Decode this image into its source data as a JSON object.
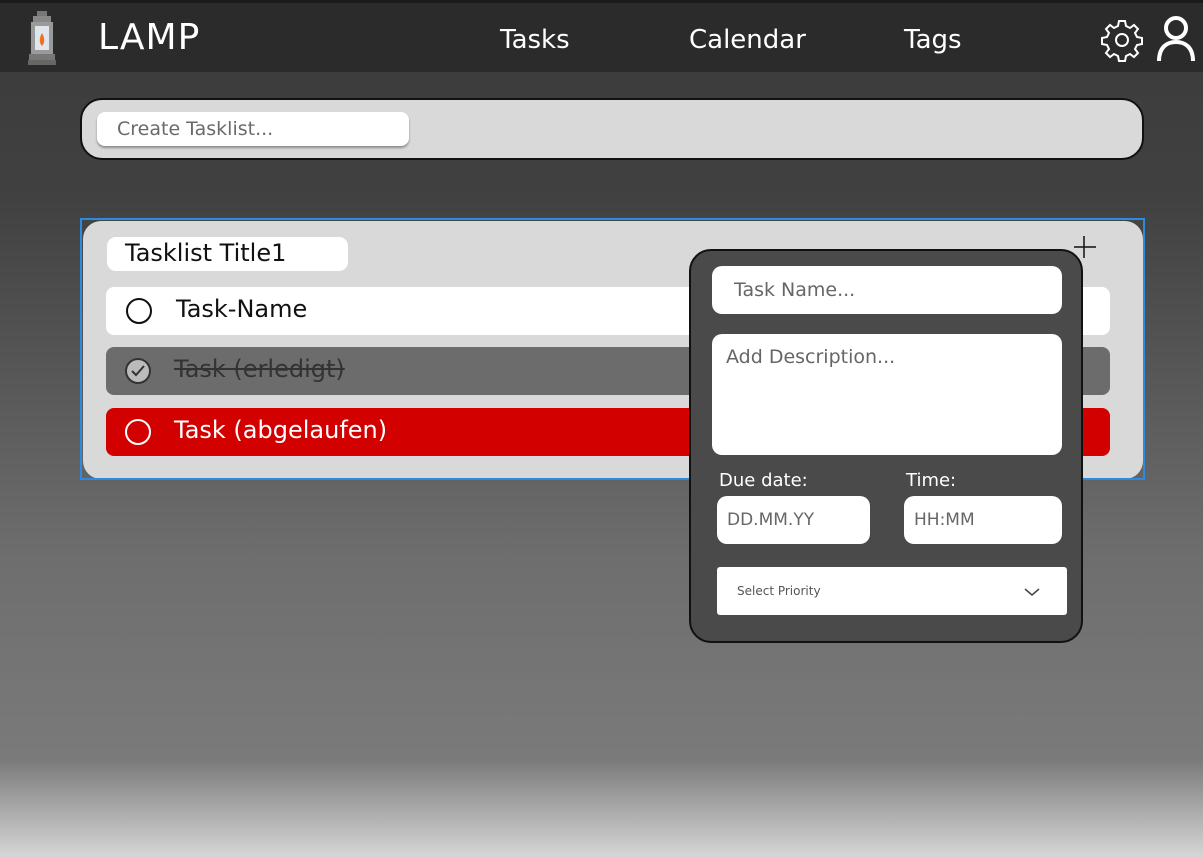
{
  "app": {
    "title": "LAMP"
  },
  "nav": {
    "tasks": "Tasks",
    "calendar": "Calendar",
    "tags": "Tags"
  },
  "create": {
    "placeholder": "Create Tasklist..."
  },
  "tasklist": {
    "title": "Tasklist Title1",
    "tasks": [
      {
        "label": "Task-Name",
        "state": "open"
      },
      {
        "label": "Task (erledigt)",
        "state": "done"
      },
      {
        "label": "Task (abgelaufen)",
        "state": "overdue"
      }
    ]
  },
  "popup": {
    "task_name_placeholder": "Task Name...",
    "description_placeholder": "Add Description...",
    "due_label": "Due date:",
    "due_placeholder": "DD.MM.YY",
    "time_label": "Time:",
    "time_placeholder": "HH:MM",
    "priority_label": "Select Priority"
  },
  "colors": {
    "topbar": "#2b2b2b",
    "overdue": "#d30000",
    "done": "#6c6c6c",
    "selection": "#2b8be0"
  },
  "icons": [
    "lantern-logo-icon",
    "gear-icon",
    "user-icon",
    "circle-check-icon",
    "chevron-down-icon",
    "plus-icon"
  ]
}
